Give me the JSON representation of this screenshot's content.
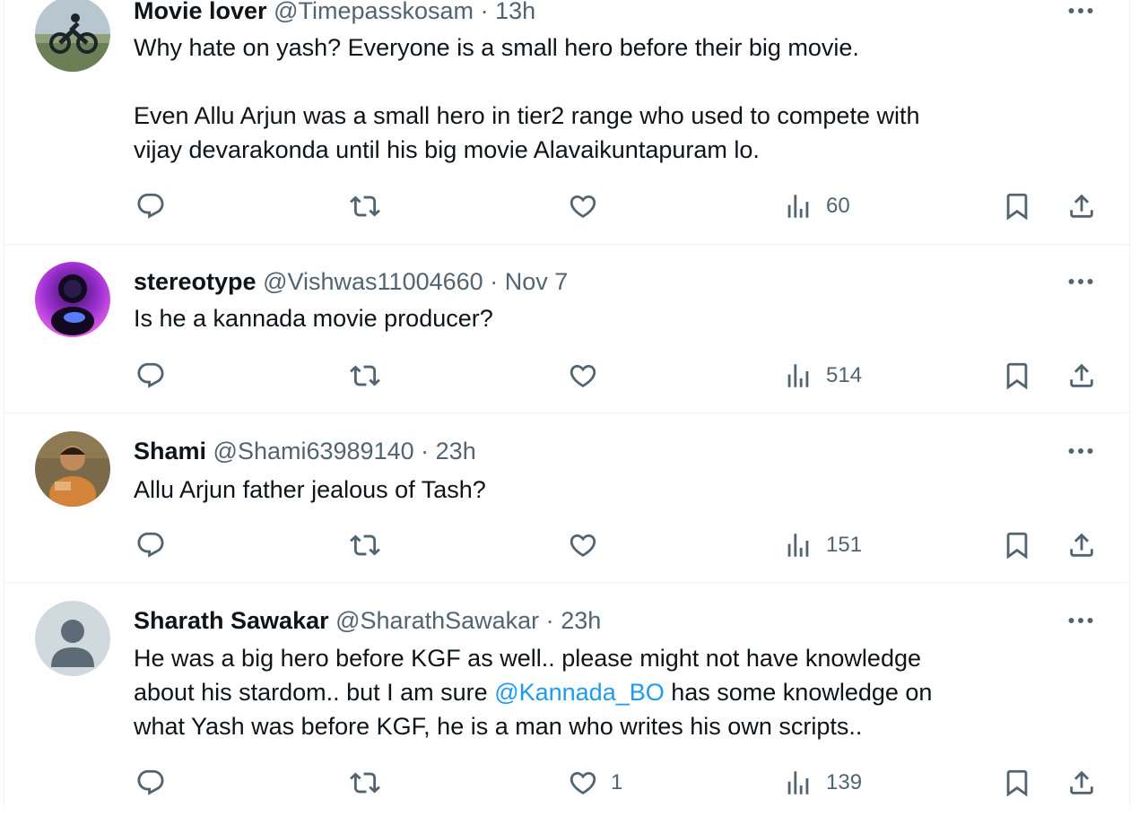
{
  "tweets": [
    {
      "name": "Movie lover",
      "handle": "@Timepasskosam",
      "sep": "·",
      "time": "13h",
      "body": [
        "Why hate on yash? Everyone is a small hero before their big movie.",
        "",
        "Even Allu Arjun was a small hero in tier2 range who used to compete with",
        "vijay devarakonda until his big movie Alavaikuntapuram lo."
      ],
      "likes": "",
      "views": "60"
    },
    {
      "name": "stereotype",
      "handle": "@Vishwas11004660",
      "sep": "·",
      "time": "Nov 7",
      "body": [
        "Is he a kannada movie producer?"
      ],
      "likes": "",
      "views": "514"
    },
    {
      "name": "Shami",
      "handle": "@Shami63989140",
      "sep": "·",
      "time": "23h",
      "body": [
        "Allu Arjun father jealous of Tash?"
      ],
      "likes": "",
      "views": "151"
    },
    {
      "name": "Sharath Sawakar",
      "handle": "@SharathSawakar",
      "sep": "·",
      "time": "23h",
      "body_parts": {
        "line1": "He was a big hero before KGF as well.. please might not have knowledge",
        "line2_before": "about his stardom.. but I am sure ",
        "line2_mention": "@Kannada_BO",
        "line2_after": " has some knowledge on",
        "line3": "what Yash was before KGF, he is a man who writes his own scripts.."
      },
      "likes": "1",
      "views": "139"
    }
  ],
  "icons": {
    "reply": "reply-icon",
    "retweet": "retweet-icon",
    "like": "heart-icon",
    "views": "views-icon",
    "bookmark": "bookmark-icon",
    "share": "share-icon",
    "more": "more-icon"
  },
  "colors": {
    "text": "#0f1419",
    "secondary": "#536471",
    "link": "#1d9bf0",
    "divider": "#eff3f4"
  }
}
